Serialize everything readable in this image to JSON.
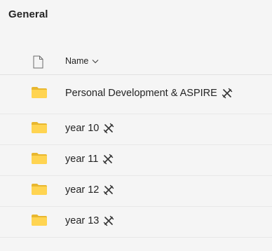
{
  "section": {
    "title": "General"
  },
  "list": {
    "header": {
      "name_label": "Name",
      "file_icon": "file-icon",
      "sort_icon": "chevron-down-icon"
    },
    "items": [
      {
        "name": "Personal Development & ASPIRE",
        "icon": "folder-icon",
        "badge_icon": "sync-pin-icon"
      },
      {
        "name": "year 10",
        "icon": "folder-icon",
        "badge_icon": "sync-pin-icon"
      },
      {
        "name": "year 11",
        "icon": "folder-icon",
        "badge_icon": "sync-pin-icon"
      },
      {
        "name": "year 12",
        "icon": "folder-icon",
        "badge_icon": "sync-pin-icon"
      },
      {
        "name": "year 13",
        "icon": "folder-icon",
        "badge_icon": "sync-pin-icon"
      }
    ]
  },
  "colors": {
    "folder": "#FFD451",
    "folder_dark": "#E8B72F",
    "background": "#F5F5F5",
    "text": "#242424"
  }
}
